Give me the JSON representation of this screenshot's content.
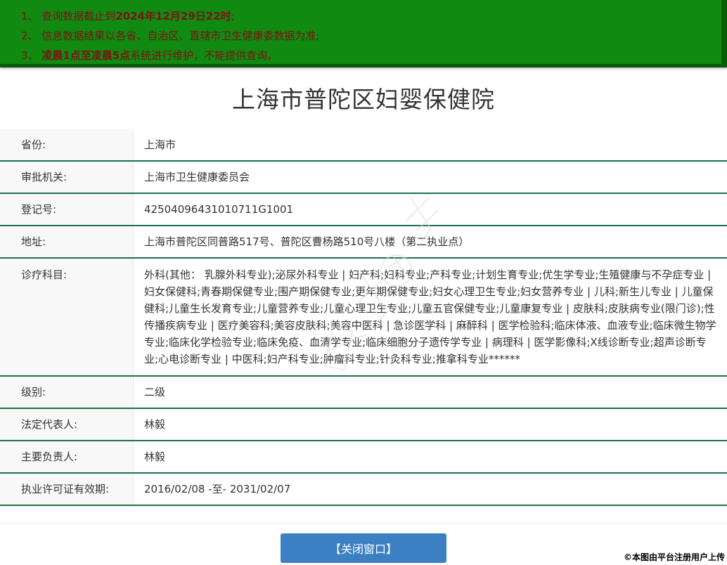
{
  "colors": {
    "banner_green": "#118a11",
    "banner_border": "#0a5c0a",
    "notice_red": "#7a1414",
    "line_green": "#1e7145",
    "button_blue": "#3c80c4"
  },
  "banner": {
    "notices": [
      {
        "prefix": "1、 查询数据截止到",
        "bold": "2024年12月29日22时",
        "suffix": ";"
      },
      {
        "prefix": "2、 信息数据结果以各省、自治区、直辖市卫生健康委数据为准;",
        "bold": "",
        "suffix": ""
      },
      {
        "prefix": "3、 ",
        "bold": "凌晨1点至凌晨5点",
        "suffix": "系统进行维护，不能提供查询。"
      }
    ]
  },
  "page": {
    "title": "上海市普陀区妇婴保健院"
  },
  "table": {
    "rows": [
      {
        "label": "省份:",
        "value": "上海市"
      },
      {
        "label": "审批机关:",
        "value": "上海市卫生健康委员会"
      },
      {
        "label": "登记号:",
        "value": "42504096431010711G1001"
      },
      {
        "label": "地址:",
        "value": "上海市普陀区同普路517号、普陀区曹杨路510号八楼（第二执业点）"
      },
      {
        "label": "诊疗科目:",
        "value": "外科(其他： 乳腺外科专业);泌尿外科专业 | 妇产科;妇科专业;产科专业;计划生育专业;优生学专业;生殖健康与不孕症专业 | 妇女保健科;青春期保健专业;围产期保健专业;更年期保健专业;妇女心理卫生专业;妇女营养专业 | 儿科;新生儿专业 | 儿童保健科;儿童生长发育专业;儿童营养专业;儿童心理卫生专业;儿童五官保健专业;儿童康复专业 | 皮肤科;皮肤病专业(限门诊);性传播疾病专业 | 医疗美容科;美容皮肤科;美容中医科 | 急诊医学科 | 麻醉科 | 医学检验科;临床体液、血液专业;临床微生物学专业;临床化学检验专业;临床免疫、血清学专业;临床细胞分子遗传学专业 | 病理科 | 医学影像科;X线诊断专业;超声诊断专业;心电诊断专业 | 中医科;妇产科专业;肿瘤科专业;针灸科专业;推拿科专业******"
      },
      {
        "label": "级别:",
        "value": "二级"
      },
      {
        "label": "法定代表人:",
        "value": "林毅"
      },
      {
        "label": "主要负责人:",
        "value": "林毅"
      },
      {
        "label": "执业许可证有效期:",
        "value": "2016/02/08 -至- 2031/02/07"
      }
    ]
  },
  "footer": {
    "close_button": "【关闭窗口】",
    "copyright": "©本图由平台注册用户上传"
  }
}
